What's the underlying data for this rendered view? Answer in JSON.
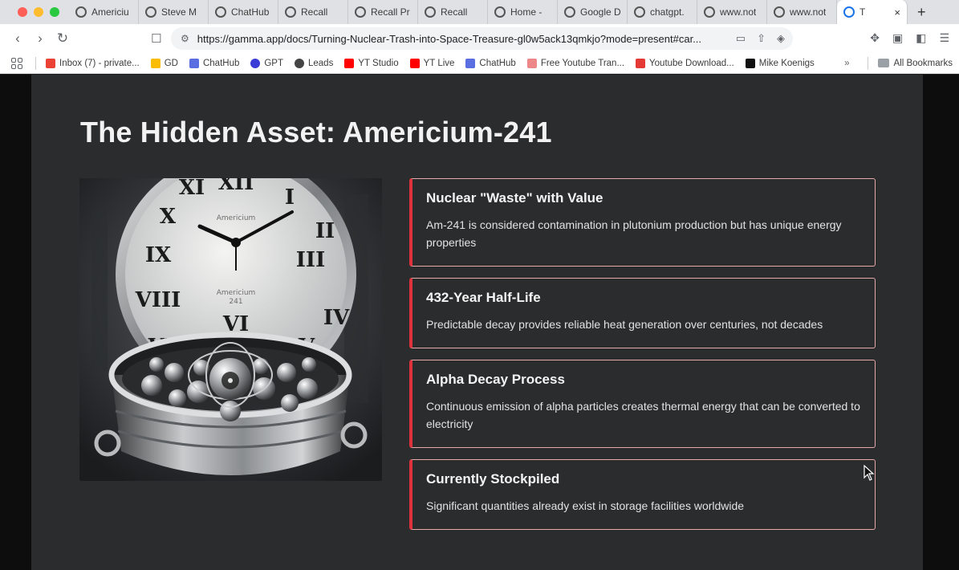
{
  "browser": {
    "tabs": [
      {
        "label": "Americiu"
      },
      {
        "label": "Steve M"
      },
      {
        "label": "ChatHub"
      },
      {
        "label": "Recall"
      },
      {
        "label": "Recall Pr"
      },
      {
        "label": "Recall"
      },
      {
        "label": "Home -"
      },
      {
        "label": "Google D"
      },
      {
        "label": "chatgpt."
      },
      {
        "label": "www.not"
      },
      {
        "label": "www.not"
      },
      {
        "label": "T"
      }
    ],
    "active_tab_close": "×",
    "new_tab": "+",
    "url": "https://gamma.app/docs/Turning-Nuclear-Trash-into-Space-Treasure-gl0w5ack13qmkjo?mode=present#car...",
    "bookmarks": [
      {
        "label": "Inbox (7) - private...",
        "color": "#ea4335"
      },
      {
        "label": "GD",
        "color": "#fbbc04"
      },
      {
        "label": "ChatHub",
        "color": "#5b6ee1"
      },
      {
        "label": "GPT",
        "color": "#3b3bd6"
      },
      {
        "label": "Leads",
        "color": "#444444"
      },
      {
        "label": "YT Studio",
        "color": "#ff0000"
      },
      {
        "label": "YT Live",
        "color": "#ff0000"
      },
      {
        "label": "ChatHub",
        "color": "#5b6ee1"
      },
      {
        "label": "Free Youtube Tran...",
        "color": "#e88"
      },
      {
        "label": "Youtube Download...",
        "color": "#e53935"
      },
      {
        "label": "Mike Koenigs",
        "color": "#111111"
      }
    ],
    "bookmarks_more": "»",
    "all_bookmarks": "All Bookmarks"
  },
  "slide": {
    "title": "The Hidden Asset: Americium-241",
    "image_alt": "Clock face with Americium 241 label above a pot of metallic spheres",
    "clock_text_1": "Americium",
    "clock_text_2": "Americium",
    "clock_text_3": "241",
    "cards": [
      {
        "heading": "Nuclear \"Waste\" with Value",
        "body": "Am-241 is considered contamination in plutonium production but has unique energy properties"
      },
      {
        "heading": "432-Year Half-Life",
        "body": "Predictable decay provides reliable heat generation over centuries, not decades"
      },
      {
        "heading": "Alpha Decay Process",
        "body": "Continuous emission of alpha particles creates thermal energy that can be converted to electricity"
      },
      {
        "heading": "Currently Stockpiled",
        "body": "Significant quantities already exist in storage facilities worldwide"
      }
    ],
    "accent_color": "#e0323a",
    "border_color": "#e9a8aa",
    "background_color": "#2b2c2e"
  }
}
